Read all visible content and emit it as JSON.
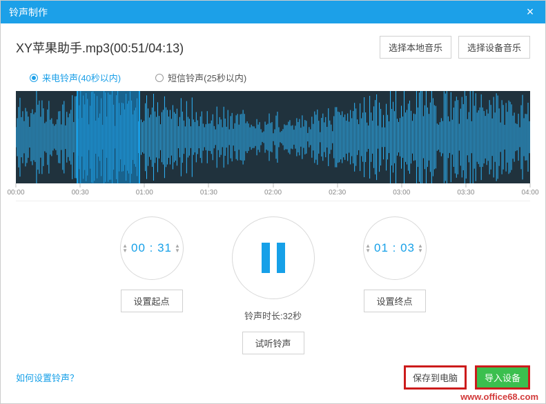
{
  "titlebar": {
    "title": "铃声制作",
    "close": "×"
  },
  "file": {
    "name": "XY苹果助手.mp3(00:51/04:13)",
    "select_local": "选择本地音乐",
    "select_device": "选择设备音乐"
  },
  "radios": {
    "call": "来电铃声(40秒以内)",
    "sms": "短信铃声(25秒以内)"
  },
  "timeline": {
    "ticks": [
      "00:00",
      "00:30",
      "01:00",
      "01:30",
      "02:00",
      "02:30",
      "03:00",
      "03:30",
      "04:00"
    ]
  },
  "selection": {
    "left_pct": 11.8,
    "width_pct": 12.4
  },
  "controls": {
    "start_time": "00 : 31",
    "end_time": "01 : 03",
    "set_start": "设置起点",
    "set_end": "设置终点",
    "duration_label": "铃声时长:32秒",
    "preview": "试听铃声"
  },
  "footer": {
    "help": "如何设置铃声？",
    "save_pc": "保存到电脑",
    "import_device": "导入设备"
  },
  "watermark": "www.office68.com"
}
